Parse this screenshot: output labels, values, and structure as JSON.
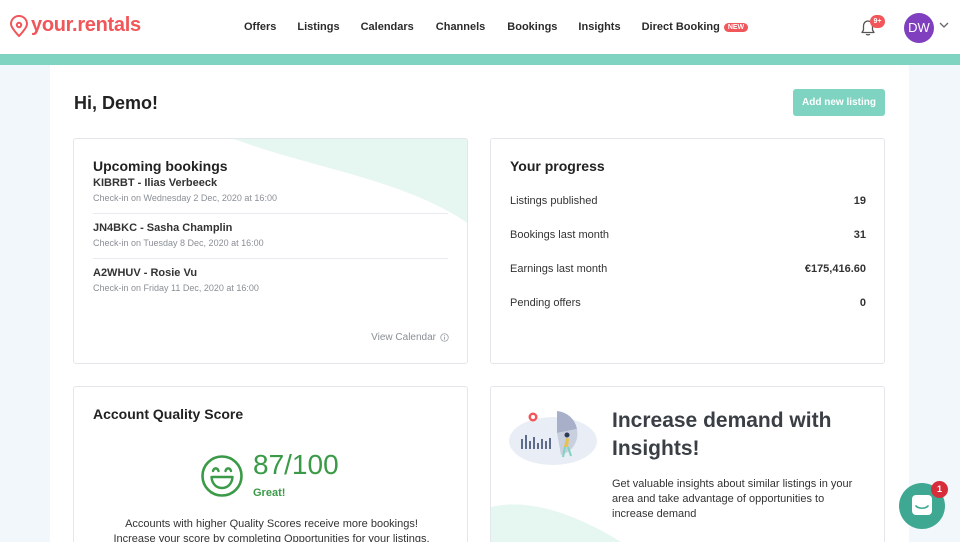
{
  "brand": {
    "logo_text": "your",
    "logo_dot": ".",
    "logo_text2": "rentals",
    "accent": "#7ed3c1",
    "brand_color": "#f0565a"
  },
  "nav": {
    "items": [
      "Offers",
      "Listings",
      "Calendars",
      "Channels",
      "Bookings",
      "Insights",
      "Direct Booking"
    ],
    "new_badge": "NEW"
  },
  "header": {
    "notifications_badge": "9+",
    "avatar_initials": "DW"
  },
  "main": {
    "greeting": "Hi, Demo!",
    "add_listing_label": "Add new listing"
  },
  "bookings": {
    "title": "Upcoming bookings",
    "items": [
      {
        "name": "KIBRBT - Ilias Verbeeck",
        "checkin": "Check-in on Wednesday 2 Dec, 2020 at 16:00"
      },
      {
        "name": "JN4BKC - Sasha Champlin",
        "checkin": "Check-in on Tuesday 8 Dec, 2020 at 16:00"
      },
      {
        "name": "A2WHUV - Rosie Vu",
        "checkin": "Check-in on Friday 11 Dec, 2020 at 16:00"
      }
    ],
    "view_calendar": "View Calendar"
  },
  "progress": {
    "title": "Your progress",
    "rows": [
      {
        "label": "Listings published",
        "value": "19"
      },
      {
        "label": "Bookings last month",
        "value": "31"
      },
      {
        "label": "Earnings last month",
        "value": "€175,416.60"
      },
      {
        "label": "Pending offers",
        "value": "0"
      }
    ]
  },
  "quality": {
    "title": "Account Quality Score",
    "score": "87/100",
    "rating": "Great!",
    "description_line1": "Accounts with higher Quality Scores receive more bookings!",
    "description_line2": "Increase your score by completing Opportunities for your listings."
  },
  "insights": {
    "title": "Increase demand with Insights!",
    "description": "Get valuable insights about similar listings in your area and take advantage of opportunities to increase demand"
  },
  "chat": {
    "badge": "1"
  }
}
